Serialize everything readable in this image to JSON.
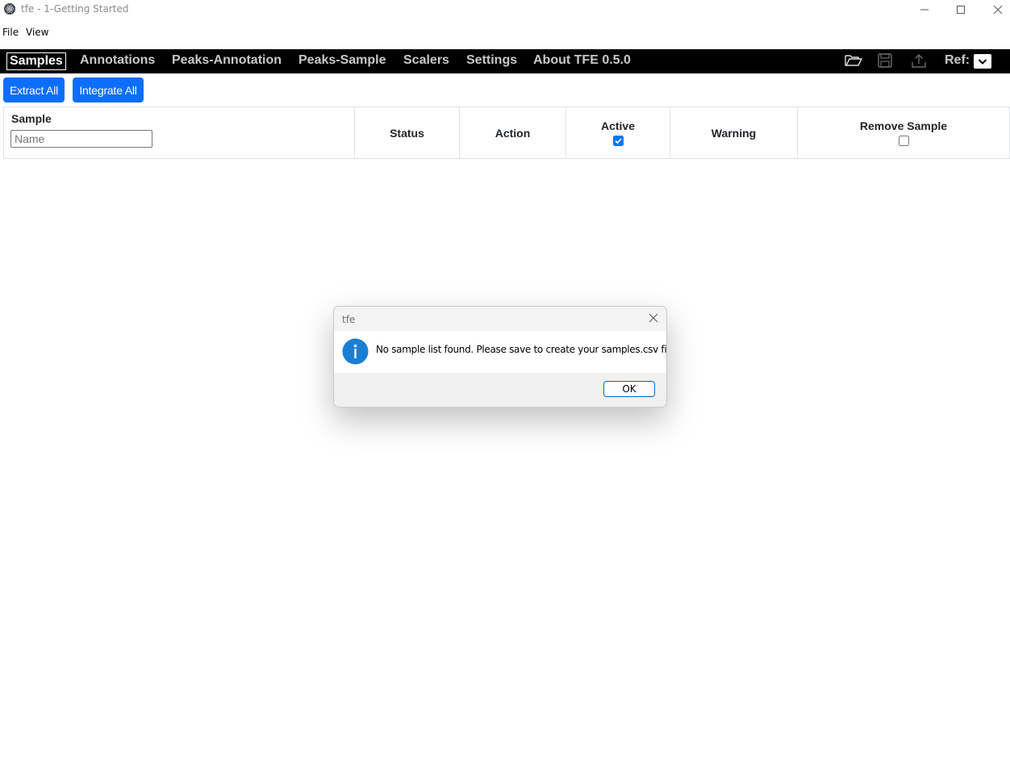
{
  "window": {
    "title": "tfe - 1-Getting Started"
  },
  "menu": {
    "items": [
      "File",
      "View"
    ]
  },
  "nav": {
    "tabs": [
      "Samples",
      "Annotations",
      "Peaks-Annotation",
      "Peaks-Sample",
      "Scalers",
      "Settings",
      "About TFE 0.5.0"
    ],
    "active_tab": "Samples",
    "icons": [
      "folder-open-icon",
      "save-icon",
      "upload-icon"
    ],
    "ref_label": "Ref:"
  },
  "actions": {
    "extract_all": "Extract All",
    "integrate_all": "Integrate All"
  },
  "table": {
    "columns": [
      "Sample",
      "Status",
      "Action",
      "Active",
      "Warning",
      "Remove Sample"
    ],
    "name_placeholder": "Name",
    "active_checked": true,
    "remove_checked": false,
    "rows": []
  },
  "dialog": {
    "title": "tfe",
    "message": "No sample list found. Please save to create your samples.csv file.",
    "ok_label": "OK",
    "icon": "info-icon"
  },
  "colors": {
    "accent": "#0d6efd",
    "navbar": "#000000",
    "dialog_info": "#1a7fd4"
  }
}
